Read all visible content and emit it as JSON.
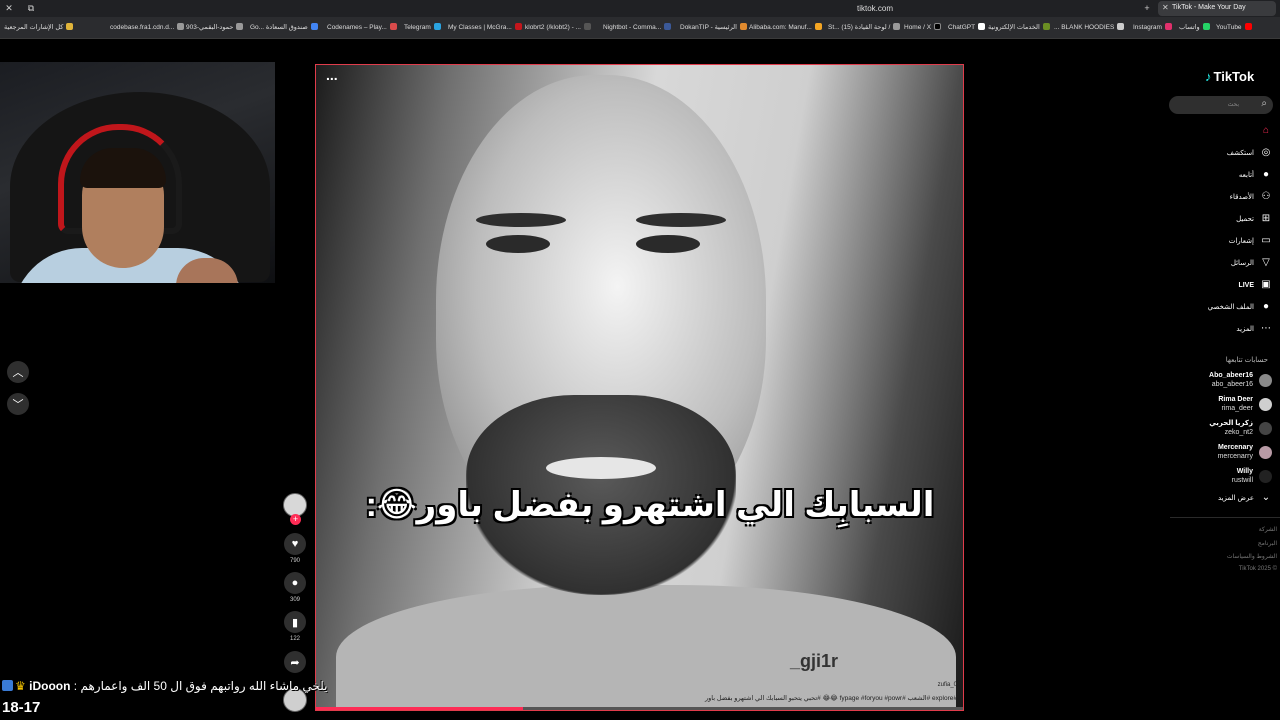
{
  "browser": {
    "url": "tiktok.com",
    "active_tab": "TikTok - Make Your Day"
  },
  "bookmarks": [
    {
      "label": "كل الإشارات المرجعية",
      "color": "#e0b43a"
    },
    {
      "label": "codebase.fra1.cdn.d...",
      "color": "#999999"
    },
    {
      "label": "903-حمود-البقمي",
      "color": "#999999"
    },
    {
      "label": "Go... صندوق السعادة",
      "color": "#4285f4"
    },
    {
      "label": "Codenames – Play...",
      "color": "#d94b4b"
    },
    {
      "label": "Telegram",
      "color": "#2aa3e0"
    },
    {
      "label": "My Classes | McGra...",
      "color": "#c4161c"
    },
    {
      "label": "klobrt2 (/klobt2) - ...",
      "color": "#555555"
    },
    {
      "label": "Nightbot - Comma...",
      "color": "#3b5998"
    },
    {
      "label": "DokanTIP - الرئيسية",
      "color": "#e08a2e"
    },
    {
      "label": "Alibaba.com: Manuf...",
      "color": "#f5a623"
    },
    {
      "label": "St... (15) لوحة القيادة /",
      "color": "#999999"
    },
    {
      "label": "Home / X",
      "color": "#000000"
    },
    {
      "label": "ChatGPT",
      "color": "#ffffff"
    },
    {
      "label": "الخدمات الإلكترونية",
      "color": "#6b8e23"
    },
    {
      "label": "... BLANK HOODIES",
      "color": "#cccccc"
    },
    {
      "label": "Instagram",
      "color": "#e1306c"
    },
    {
      "label": "واتساب",
      "color": "#25d366"
    },
    {
      "label": "YouTube",
      "color": "#ff0000"
    }
  ],
  "video": {
    "more_label": "...",
    "caption": "السبابِك الي اشتهرو بفضل باور😂:",
    "watermark": "_gji1r",
    "username": "zufia_0",
    "description": "#explore #الشعب #fypage #foryou #powr 😂😂 #تحبي يتحبو السبابك الي اشتهرو بفضل باور",
    "progress": 0.32
  },
  "actions": {
    "likes": "790",
    "comments": "309",
    "saves": "122"
  },
  "chat": {
    "user": "iDooon",
    "message": ": يلخي ماشاء الله رواتبهم فوق ال 50 الف واعمارهم",
    "score": "18-17"
  },
  "sidebar": {
    "logo": "TikTok",
    "search_placeholder": "بحث",
    "nav": [
      {
        "label": "",
        "icon": "home-icon",
        "glyph": "⌂"
      },
      {
        "label": "استكشف",
        "icon": "explore-icon",
        "glyph": "◎"
      },
      {
        "label": "أتابعه",
        "icon": "following-icon",
        "glyph": "●"
      },
      {
        "label": "الأصدقاء",
        "icon": "friends-icon",
        "glyph": "⚇"
      },
      {
        "label": "تحميل",
        "icon": "upload-icon",
        "glyph": "⊞"
      },
      {
        "label": "إشعارات",
        "icon": "activity-icon",
        "glyph": "▭"
      },
      {
        "label": "الرسائل",
        "icon": "messages-icon",
        "glyph": "▽"
      },
      {
        "label": "LIVE",
        "icon": "live-icon",
        "glyph": "▣"
      },
      {
        "label": "الملف الشخصي",
        "icon": "profile-icon",
        "glyph": "●"
      },
      {
        "label": "المزيد",
        "icon": "more-icon",
        "glyph": "⋯"
      }
    ],
    "following_title": "حسابات تتابعها",
    "following": [
      {
        "name": "Abo_abeer16",
        "handle": "abo_abeer16"
      },
      {
        "name": "Rima Deer",
        "handle": "rima_deer"
      },
      {
        "name": "زكريا الحربي",
        "handle": "zeko_nt2"
      },
      {
        "name": "Mercenary",
        "handle": "mercenarry"
      },
      {
        "name": "Willy",
        "handle": "rustwill"
      }
    ],
    "see_more": "عرض المزيد",
    "footer": [
      "الشركة",
      "البرنامج",
      "الشروط والسياسات",
      "TikTok 2025 ©"
    ]
  }
}
